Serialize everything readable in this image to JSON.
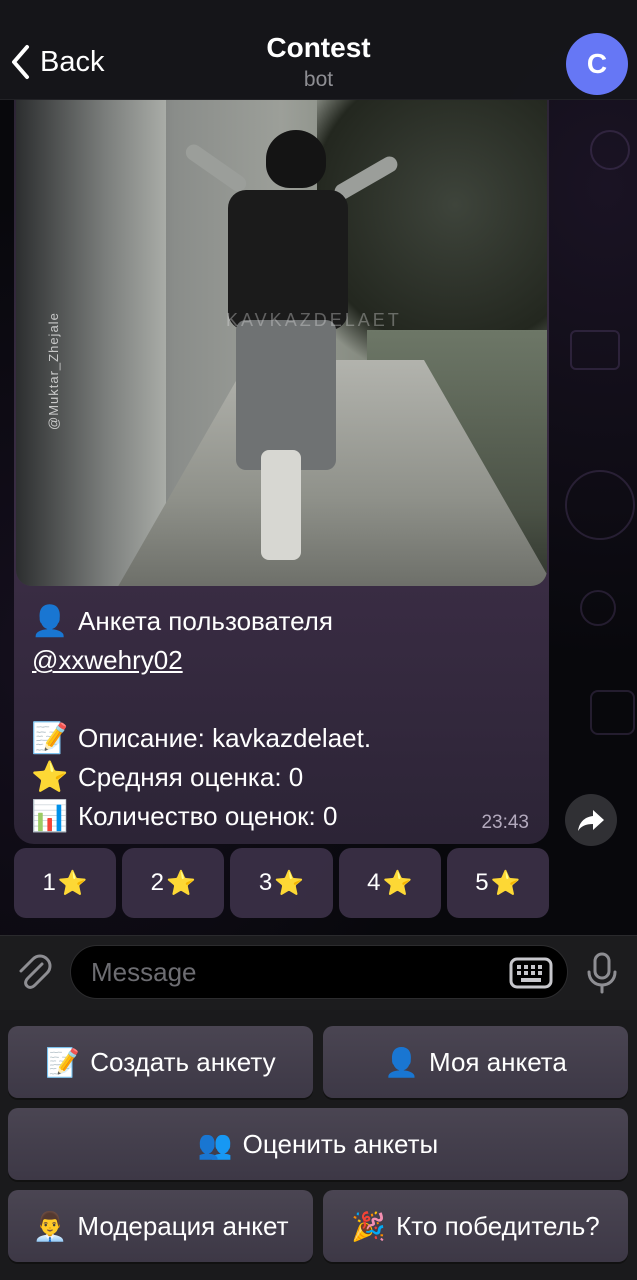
{
  "header": {
    "back_label": "Back",
    "title": "Contest",
    "subtitle": "bot",
    "avatar_letter": "C",
    "avatar_color": "#6677f5"
  },
  "photo": {
    "watermark_vertical": "@Muktar_Zhejale",
    "watermark_center": "KAVKAZDELAET"
  },
  "message": {
    "lines": [
      {
        "emoji": "👤",
        "text": "Анкета пользователя"
      },
      {
        "emoji": "",
        "text": "@xxwehry02"
      },
      {
        "emoji": "📝",
        "text": "Описание: kavkazdelaet."
      },
      {
        "emoji": "⭐",
        "text": "Средняя оценка: 0"
      },
      {
        "emoji": "📊",
        "text": "Количество оценок: 0"
      }
    ],
    "time": "23:43"
  },
  "inline_keyboard": [
    {
      "label": "1",
      "emoji": "⭐"
    },
    {
      "label": "2",
      "emoji": "⭐"
    },
    {
      "label": "3",
      "emoji": "⭐"
    },
    {
      "label": "4",
      "emoji": "⭐"
    },
    {
      "label": "5",
      "emoji": "⭐"
    }
  ],
  "input": {
    "placeholder": "Message"
  },
  "reply_keyboard": [
    {
      "emoji": "📝",
      "label": "Создать анкету"
    },
    {
      "emoji": "👤",
      "label": "Моя анкета"
    },
    {
      "emoji": "👥",
      "label": "Оценить анкеты"
    },
    {
      "emoji": "👨‍💼",
      "label": "Модерация анкет"
    },
    {
      "emoji": "🎉",
      "label": "Кто победитель?"
    }
  ],
  "colors": {
    "bubble": "#35293f",
    "input_bar": "#1c1c1e",
    "keyboard_button": "#444050"
  },
  "icons": {
    "back": "chevron-left-icon",
    "forward": "share-arrow-icon",
    "attach": "paperclip-icon",
    "keyboard": "keyboard-icon",
    "mic": "microphone-icon"
  }
}
